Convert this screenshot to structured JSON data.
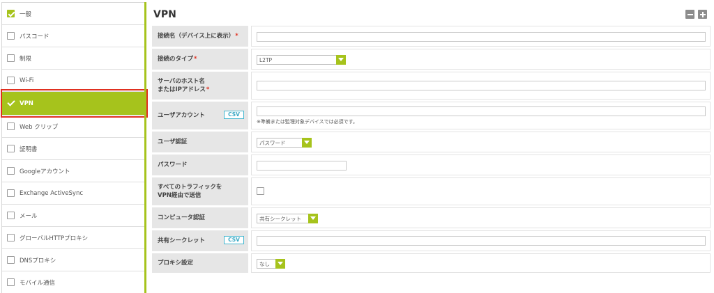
{
  "sidebar": {
    "items": [
      {
        "label": "一般",
        "checked": true
      },
      {
        "label": "パスコード",
        "checked": false
      },
      {
        "label": "制限",
        "checked": false
      },
      {
        "label": "Wi-Fi",
        "checked": false
      },
      {
        "label": "VPN",
        "checked": true,
        "active": true
      },
      {
        "label": "Web クリップ",
        "checked": false
      },
      {
        "label": "証明書",
        "checked": false
      },
      {
        "label": "Googleアカウント",
        "checked": false
      },
      {
        "label": "Exchange ActiveSync",
        "checked": false
      },
      {
        "label": "メール",
        "checked": false
      },
      {
        "label": "グローバルHTTPプロキシ",
        "checked": false
      },
      {
        "label": "DNSプロキシ",
        "checked": false
      },
      {
        "label": "モバイル通信",
        "checked": false
      }
    ]
  },
  "main": {
    "title": "VPN",
    "zoom_out_icon": "minus-icon",
    "zoom_in_icon": "plus-icon",
    "rows": {
      "connection_name": {
        "label": "接続名（デバイス上に表示）",
        "required_mark": "*",
        "value": ""
      },
      "connection_type": {
        "label": "接続のタイプ",
        "required_mark": "*",
        "selected": "L2TP"
      },
      "server_host": {
        "label_line1": "サーバのホスト名",
        "label_line2": "またはIPアドレス",
        "required_mark": "*",
        "value": ""
      },
      "user_account": {
        "label": "ユーザアカウント",
        "csv": "CSV",
        "value": "",
        "hint": "※準備または監理対象デバイスでは必須です。"
      },
      "user_auth": {
        "label": "ユーザ認証",
        "selected": "パスワード"
      },
      "password": {
        "label": "パスワード",
        "value": ""
      },
      "send_all_traffic": {
        "label_line1": "すべてのトラフィックを",
        "label_line2": "VPN経由で送信",
        "checked": false
      },
      "machine_auth": {
        "label": "コンピュータ認証",
        "selected": "共有シークレット"
      },
      "shared_secret": {
        "label": "共有シークレット",
        "csv": "CSV",
        "value": ""
      },
      "proxy": {
        "label": "プロキシ設定",
        "selected": "なし"
      }
    }
  },
  "colors": {
    "accent": "#a6c31c",
    "highlight": "#e03020",
    "csv": "#45b7d0",
    "label_bg": "#e6e6e6"
  }
}
